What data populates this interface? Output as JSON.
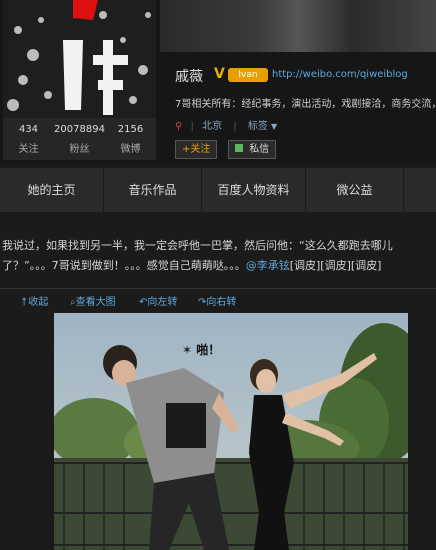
{
  "profile": {
    "name": "戚薇",
    "v_badge": "V",
    "level_badge": "Ivan",
    "url": "http://weibo.com/qiweiblog",
    "description": "7哥相关所有：经纪事务，演出活动，戏剧接洽，商务交流，",
    "location_icon": "location-pin-icon",
    "location": "北京",
    "tags_label": "标签",
    "follow_label": "+关注",
    "message_label": "私信",
    "stats": [
      {
        "value": "434",
        "label": "关注"
      },
      {
        "value": "20078894",
        "label": "粉丝"
      },
      {
        "value": "2156",
        "label": "微博"
      }
    ]
  },
  "nav": {
    "items": [
      "她的主页",
      "音乐作品",
      "百度人物资料",
      "微公益"
    ]
  },
  "post": {
    "text": "我说过，如果找到另一半，我一定会呼他一巴掌，然后问他：“这么久都跑去哪儿了？”。。。7哥说到做到！。。。感觉自己萌萌哒。。。",
    "mention": "@李承铉",
    "tail": "[调皮][调皮][调皮]"
  },
  "toolbar": {
    "collapse": "收起",
    "view_large": "查看大图",
    "rotate_left": "向左转",
    "rotate_right": "向右转"
  },
  "photo": {
    "caption_text": "啪！"
  }
}
